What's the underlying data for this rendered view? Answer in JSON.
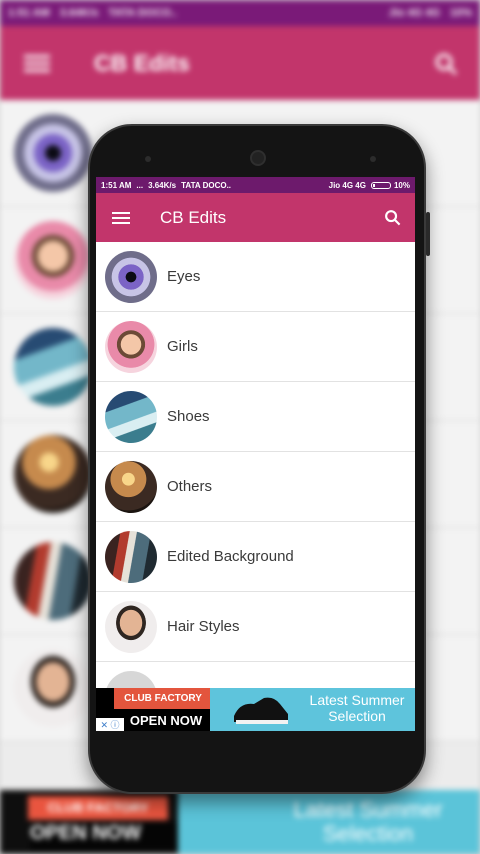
{
  "background_blurred": {
    "status": {
      "time": "1:51 AM",
      "speed": "3.64K/s",
      "carrier1": "TATA DOCO..",
      "carrier2": "Jio 4G 4G",
      "battery": "10%"
    },
    "appbar_title": "CB Edits",
    "ad_brand": "CLUB FACTORY",
    "ad_cta": "OPEN NOW",
    "ad_headline": "Latest Summer Selection"
  },
  "screen": {
    "status": {
      "time": "1:51 AM",
      "dots": "...",
      "speed": "3.64K/s",
      "carrier1": "TATA DOCO..",
      "carrier2": "Jio 4G 4G",
      "battery": "10%"
    },
    "appbar": {
      "title": "CB Edits",
      "menu_icon": "menu-icon",
      "search_icon": "search-icon"
    },
    "categories": [
      {
        "label": "Eyes"
      },
      {
        "label": "Girls"
      },
      {
        "label": "Shoes"
      },
      {
        "label": "Others"
      },
      {
        "label": "Edited Background"
      },
      {
        "label": "Hair Styles"
      }
    ],
    "ad": {
      "brand": "CLUB FACTORY",
      "cta": "OPEN NOW",
      "headline": "Latest Summer Selection",
      "adchoices_icon": "adchoices-icon"
    }
  },
  "colors": {
    "status_bar": "#6d1a6c",
    "app_bar": "#c2356b",
    "ad_brand": "#e3553d",
    "ad_creative": "#5ec4dc"
  }
}
